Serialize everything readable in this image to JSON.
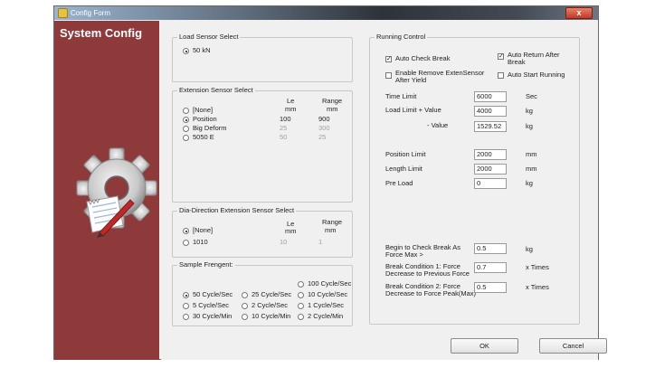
{
  "window": {
    "title": "Config Form",
    "close_label": "x",
    "sidebar_title": "System Config"
  },
  "load_sensor": {
    "label": "Load Sensor Select",
    "option": "50 kN"
  },
  "extension_sensor": {
    "label": "Extension Sensor Select",
    "col_le": "Le",
    "col_le_unit": "mm",
    "col_range": "Range",
    "col_range_unit": "mm",
    "rows": [
      {
        "name": "[None]",
        "le": "",
        "range": "",
        "selected": false,
        "enabled": true
      },
      {
        "name": "Position",
        "le": "100",
        "range": "900",
        "selected": true,
        "enabled": true
      },
      {
        "name": "Big Deform",
        "le": "25",
        "range": "300",
        "selected": false,
        "enabled": false
      },
      {
        "name": "5050 E",
        "le": "50",
        "range": "25",
        "selected": false,
        "enabled": false
      }
    ]
  },
  "dia_sensor": {
    "label": "Dia-Direction Extension Sensor Select",
    "col_le": "Le",
    "col_le_unit": "mm",
    "col_range": "Range",
    "col_range_unit": "mm",
    "rows": [
      {
        "name": "[None]",
        "le": "",
        "range": "",
        "selected": true
      },
      {
        "name": "1010",
        "le": "10",
        "range": "1",
        "selected": false
      }
    ]
  },
  "sample_frequency": {
    "label": "Sample Frengent:",
    "options": [
      {
        "label": "100 Cycle/Sec",
        "selected": false
      },
      {
        "label": "50 Cycle/Sec",
        "selected": true
      },
      {
        "label": "25 Cycle/Sec",
        "selected": false
      },
      {
        "label": "10 Cycle/Sec",
        "selected": false
      },
      {
        "label": "5 Cycle/Sec",
        "selected": false
      },
      {
        "label": "2 Cycle/Sec",
        "selected": false
      },
      {
        "label": "1 Cycle/Sec",
        "selected": false
      },
      {
        "label": "30 Cycle/Min",
        "selected": false
      },
      {
        "label": "10 Cycle/Min",
        "selected": false
      },
      {
        "label": "2 Cycle/Min",
        "selected": false
      }
    ]
  },
  "running_control": {
    "label": "Running Control",
    "auto_check_break": {
      "label": "Auto Check Break",
      "checked": true
    },
    "auto_return": {
      "label_1": "Auto Return After",
      "label_2": "Break",
      "checked": true
    },
    "enable_remove": {
      "label_1": "Enable Remove ExtenSensor",
      "label_2": "After Yield",
      "checked": false
    },
    "auto_start": {
      "label": "Auto Start Running",
      "checked": false
    },
    "time_limit": {
      "label": "Time Limit",
      "value": "6000",
      "unit": "Sec"
    },
    "load_limit_pos": {
      "label": "Load Limit  + Value",
      "value": "4000",
      "unit": "kg"
    },
    "load_limit_neg": {
      "label": "- Value",
      "value": "1529.52",
      "unit": "kg"
    },
    "position_limit": {
      "label": "Position Limit",
      "value": "2000",
      "unit": "mm"
    },
    "length_limit": {
      "label": "Length Limit",
      "value": "2000",
      "unit": "mm"
    },
    "pre_load": {
      "label": "Pre Load",
      "value": "0",
      "unit": "kg"
    },
    "begin_check": {
      "label_1": "Begin to Check Break As",
      "label_2": "Force Max >",
      "value": "0.5",
      "unit": "kg"
    },
    "break_cond_1": {
      "label_1": "Break Condition 1: Force",
      "label_2": "Decrease to Previous Force",
      "value": "0.7",
      "unit": "x Times"
    },
    "break_cond_2": {
      "label_1": "Break Condition 2: Force",
      "label_2": "Decrease to Force Peak(Max)",
      "value": "0.5",
      "unit": "x Times"
    }
  },
  "buttons": {
    "ok": "OK",
    "cancel": "Cancel"
  },
  "colors": {
    "sidebar": "#8e3a3a",
    "dialog_bg": "#f0f0f0",
    "close_button": "#c23a24"
  },
  "icons": [
    "gear-icon",
    "document-pen-icon",
    "window-app-icon"
  ]
}
